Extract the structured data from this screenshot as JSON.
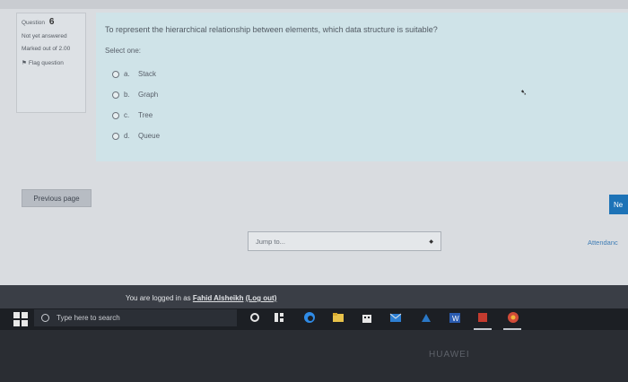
{
  "question_info": {
    "label": "Question",
    "number": "6",
    "state": "Not yet answered",
    "grade": "Marked out of 2.00",
    "flag_label": "Flag question"
  },
  "question": {
    "text": "To represent the hierarchical relationship between elements, which data structure is suitable?",
    "prompt": "Select one:",
    "answers": [
      {
        "letter": "a.",
        "label": "Stack"
      },
      {
        "letter": "b.",
        "label": "Graph"
      },
      {
        "letter": "c.",
        "label": "Tree"
      },
      {
        "letter": "d.",
        "label": "Queue"
      }
    ]
  },
  "navigation": {
    "previous_label": "Previous page",
    "next_label": "Ne",
    "jump_label": "Jump to...",
    "attendance_label": "Attendanc"
  },
  "login": {
    "prefix": "You are logged in as",
    "user": "Fahid Alsheikh",
    "logout": "(Log out)"
  },
  "taskbar": {
    "search_placeholder": "Type here to search"
  },
  "device_brand": "HUAWEI",
  "colors": {
    "content_bg": "#cfe3e8",
    "next_button": "#1d73b7",
    "taskbar": "#1c1f24"
  }
}
